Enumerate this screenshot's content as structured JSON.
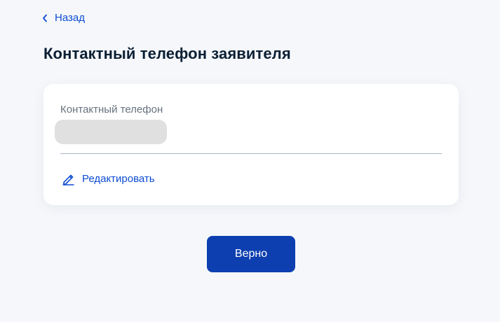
{
  "nav": {
    "back_label": "Назад"
  },
  "page": {
    "title": "Контактный телефон заявителя"
  },
  "card": {
    "field_label": "Контактный телефон",
    "edit_label": "Редактировать"
  },
  "actions": {
    "confirm_label": "Верно"
  },
  "icons": {
    "back": "chevron-left-icon",
    "edit": "pencil-icon"
  },
  "colors": {
    "accent": "#0d4cd3",
    "button": "#0d3fb0",
    "background": "#f5f7fb",
    "title": "#0b1f33",
    "label": "#66727f"
  }
}
